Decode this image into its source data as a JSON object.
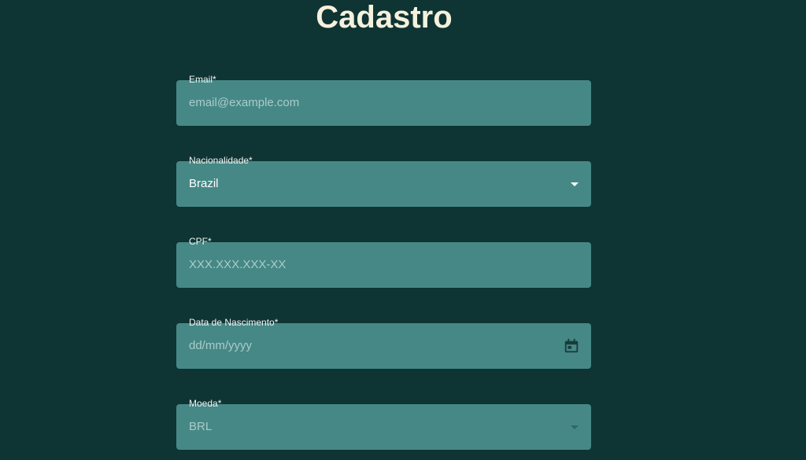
{
  "page": {
    "title": "Cadastro"
  },
  "form": {
    "email": {
      "label": "Email*",
      "placeholder": "email@example.com"
    },
    "nacionalidade": {
      "label": "Nacionalidade*",
      "value": "Brazil"
    },
    "cpf": {
      "label": "CPF*",
      "placeholder": "XXX.XXX.XXX-XX"
    },
    "nascimento": {
      "label": "Data de Nascimento*",
      "placeholder": "dd/mm/yyyy",
      "icon": "calendar-icon"
    },
    "moeda": {
      "label": "Moeda*",
      "value": "BRL"
    }
  },
  "colors": {
    "background": "#0f3434",
    "field": "#468886",
    "title": "#f5f1dc"
  }
}
